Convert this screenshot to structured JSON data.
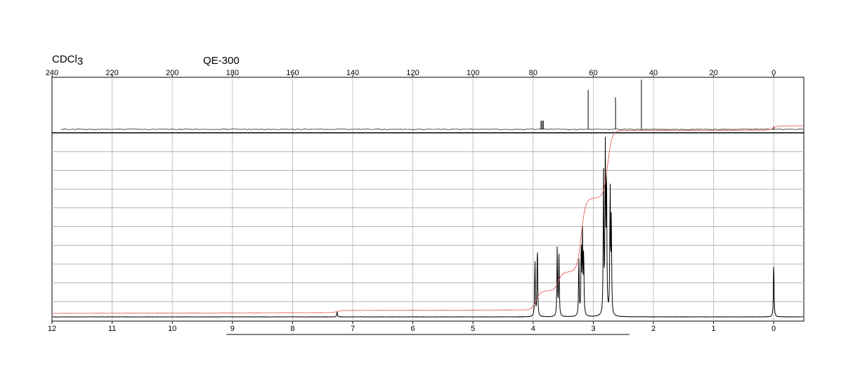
{
  "header": {
    "solvent": "CDCl",
    "solvent_sub": "3",
    "instrument": "QE-300"
  },
  "chart_data": [
    {
      "type": "line",
      "name": "13C spectrum",
      "x_range": [
        240,
        -10
      ],
      "x_ticks": [
        240,
        220,
        200,
        180,
        160,
        140,
        120,
        100,
        80,
        60,
        40,
        20,
        0
      ],
      "grid": true,
      "peaks": [
        {
          "ppm": 77.4,
          "height": 0.17
        },
        {
          "ppm": 77.0,
          "height": 0.17
        },
        {
          "ppm": 76.6,
          "height": 0.17
        },
        {
          "ppm": 61.7,
          "height": 0.78
        },
        {
          "ppm": 52.6,
          "height": 0.63
        },
        {
          "ppm": 44.0,
          "height": 0.98
        },
        {
          "ppm": 0.0,
          "height": 0.06
        }
      ]
    },
    {
      "type": "line",
      "name": "1H spectrum",
      "x_range": [
        12,
        -0.5
      ],
      "x_ticks": [
        12,
        11,
        10,
        9,
        8,
        7,
        6,
        5,
        4,
        3,
        2,
        1,
        0
      ],
      "grid": true,
      "peaks": [
        {
          "ppm": 7.26,
          "height": 0.03
        },
        {
          "ppm": 3.97,
          "height": 0.32
        },
        {
          "ppm": 3.93,
          "height": 0.41
        },
        {
          "ppm": 3.6,
          "height": 0.38
        },
        {
          "ppm": 3.57,
          "height": 0.35
        },
        {
          "ppm": 3.24,
          "height": 0.33
        },
        {
          "ppm": 3.2,
          "height": 0.4
        },
        {
          "ppm": 3.18,
          "height": 0.44
        },
        {
          "ppm": 3.16,
          "height": 0.36
        },
        {
          "ppm": 2.83,
          "height": 0.78
        },
        {
          "ppm": 2.8,
          "height": 0.97
        },
        {
          "ppm": 2.78,
          "height": 0.8
        },
        {
          "ppm": 2.72,
          "height": 0.72
        },
        {
          "ppm": 2.7,
          "height": 0.52
        },
        {
          "ppm": 0.0,
          "height": 0.32
        }
      ],
      "integration_steps": [
        {
          "ppm": 7.26,
          "value": 0.01
        },
        {
          "ppm": 3.95,
          "value": 0.09
        },
        {
          "ppm": 3.58,
          "value": 0.09
        },
        {
          "ppm": 3.2,
          "value": 0.35
        },
        {
          "ppm": 2.76,
          "value": 0.32
        },
        {
          "ppm": 0.0,
          "value": 0.02
        }
      ]
    }
  ]
}
